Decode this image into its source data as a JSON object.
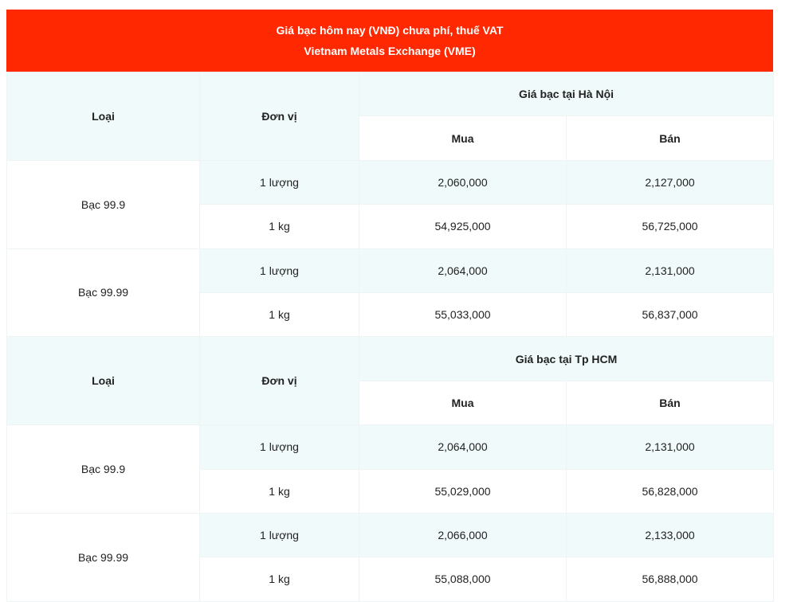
{
  "header": {
    "line1": "Giá bạc hôm nay (VNĐ) chưa phí, thuế VAT",
    "line2": "Vietnam Metals Exchange (VME)"
  },
  "columns": {
    "loai": "Loại",
    "don_vi": "Đơn vị",
    "mua": "Mua",
    "ban": "Bán"
  },
  "sections": [
    {
      "title": "Giá bạc tại Hà Nội",
      "groups": [
        {
          "type": "Bạc 99.9",
          "rows": [
            {
              "unit": "1 lượng",
              "buy": "2,060,000",
              "sell": "2,127,000"
            },
            {
              "unit": "1 kg",
              "buy": "54,925,000",
              "sell": "56,725,000"
            }
          ]
        },
        {
          "type": "Bạc 99.99",
          "rows": [
            {
              "unit": "1 lượng",
              "buy": "2,064,000",
              "sell": "2,131,000"
            },
            {
              "unit": "1 kg",
              "buy": "55,033,000",
              "sell": "56,837,000"
            }
          ]
        }
      ]
    },
    {
      "title": "Giá bạc tại Tp HCM",
      "groups": [
        {
          "type": "Bạc 99.9",
          "rows": [
            {
              "unit": "1 lượng",
              "buy": "2,064,000",
              "sell": "2,131,000"
            },
            {
              "unit": "1 kg",
              "buy": "55,029,000",
              "sell": "56,828,000"
            }
          ]
        },
        {
          "type": "Bạc 99.99",
          "rows": [
            {
              "unit": "1 lượng",
              "buy": "2,066,000",
              "sell": "2,133,000"
            },
            {
              "unit": "1 kg",
              "buy": "55,088,000",
              "sell": "56,888,000"
            }
          ]
        }
      ]
    }
  ]
}
